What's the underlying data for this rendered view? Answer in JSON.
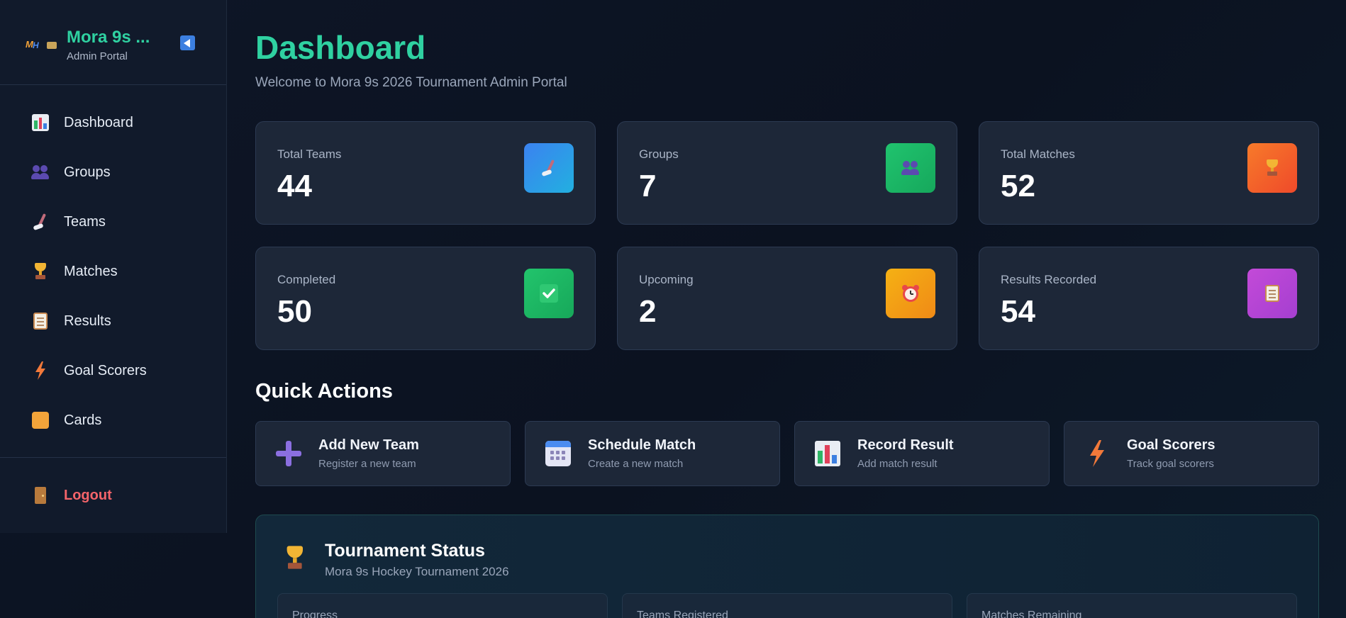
{
  "sidebar": {
    "brand_title": "Mora 9s ...",
    "brand_sub": "Admin Portal",
    "items": [
      {
        "label": "Dashboard",
        "icon": "bar-chart-icon"
      },
      {
        "label": "Groups",
        "icon": "people-icon"
      },
      {
        "label": "Teams",
        "icon": "hockey-stick-icon"
      },
      {
        "label": "Matches",
        "icon": "trophy-icon"
      },
      {
        "label": "Results",
        "icon": "clipboard-icon"
      },
      {
        "label": "Goal Scorers",
        "icon": "lightning-icon"
      },
      {
        "label": "Cards",
        "icon": "card-icon"
      }
    ],
    "logout_label": "Logout"
  },
  "header": {
    "title": "Dashboard",
    "subtitle": "Welcome to Mora 9s 2026 Tournament Admin Portal"
  },
  "stats": [
    {
      "label": "Total Teams",
      "value": "44",
      "icon": "hockey-stick-icon",
      "color": "#2f7ee6"
    },
    {
      "label": "Groups",
      "value": "7",
      "icon": "people-icon",
      "color": "#1fbf6a"
    },
    {
      "label": "Total Matches",
      "value": "52",
      "icon": "trophy-icon",
      "color": "#f2652a"
    },
    {
      "label": "Completed",
      "value": "50",
      "icon": "checkmark-icon",
      "color": "#1fbf6a"
    },
    {
      "label": "Upcoming",
      "value": "2",
      "icon": "alarm-clock-icon",
      "color": "#f29a14"
    },
    {
      "label": "Results Recorded",
      "value": "54",
      "icon": "clipboard-icon",
      "color": "#b843d6"
    }
  ],
  "quick_actions": {
    "title": "Quick Actions",
    "items": [
      {
        "title": "Add New Team",
        "desc": "Register a new team",
        "icon": "plus-icon"
      },
      {
        "title": "Schedule Match",
        "desc": "Create a new match",
        "icon": "calendar-icon"
      },
      {
        "title": "Record Result",
        "desc": "Add match result",
        "icon": "bar-chart-icon"
      },
      {
        "title": "Goal Scorers",
        "desc": "Track goal scorers",
        "icon": "lightning-icon"
      }
    ]
  },
  "tournament_status": {
    "title": "Tournament Status",
    "subtitle": "Mora 9s Hockey Tournament 2026",
    "cards": [
      {
        "label": "Progress"
      },
      {
        "label": "Teams Registered"
      },
      {
        "label": "Matches Remaining"
      }
    ]
  },
  "colors": {
    "accent": "#2fd1a1",
    "logout": "#f4646a",
    "panel": "#1d2738"
  }
}
